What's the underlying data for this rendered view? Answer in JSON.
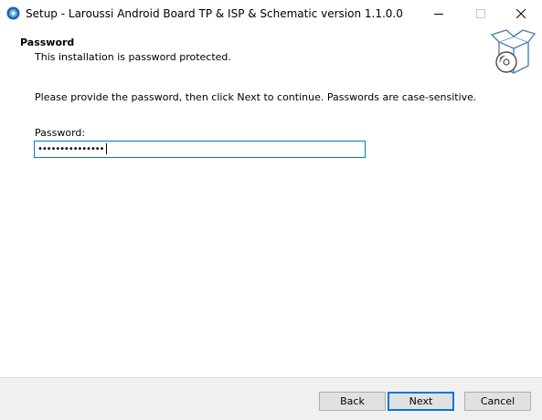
{
  "window": {
    "title": "Setup - Laroussi Android Board TP & ISP & Schematic version 1.1.0.0",
    "controls": [
      "minimize",
      "maximize",
      "close"
    ]
  },
  "header": {
    "title": "Password",
    "subtitle": "This installation is password protected."
  },
  "body": {
    "instruction": "Please provide the password, then click Next to continue. Passwords are case-sensitive.",
    "password_label": "Password:",
    "password_masked": "•••••••••••••••"
  },
  "footer": {
    "back_label": "Back",
    "next_label": "Next",
    "cancel_label": "Cancel"
  },
  "icons": {
    "app": "setup-app-icon",
    "graphic": "installer-box-disc-icon"
  },
  "colors": {
    "focus_accent": "#0078d7",
    "footer_bg": "#f0f0f0",
    "button_bg": "#e1e1e1"
  }
}
